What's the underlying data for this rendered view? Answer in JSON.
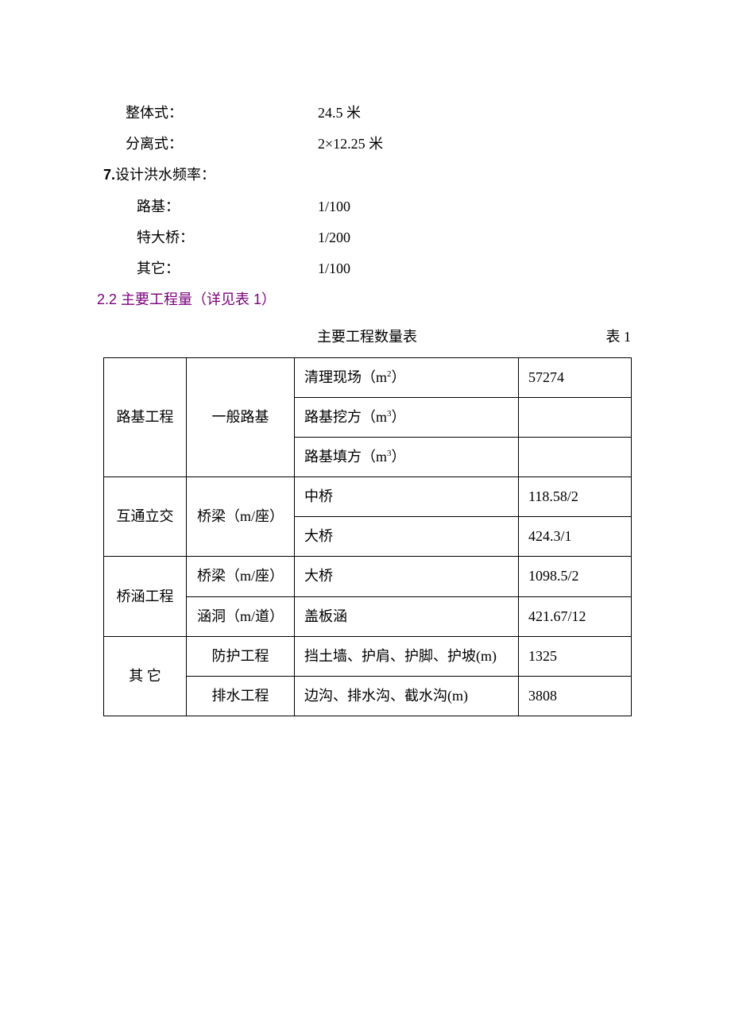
{
  "specs": [
    {
      "label": "整体式：",
      "value": "24.5 米",
      "cls": "indent-1"
    },
    {
      "label": "分离式：",
      "value": "2×12.25 米",
      "cls": "indent-1"
    },
    {
      "label_num": "7.",
      "label": "设计洪水频率：",
      "value": "",
      "cls": ""
    },
    {
      "label": "路基：",
      "value": "1/100",
      "cls": "indent-2"
    },
    {
      "label": "特大桥：",
      "value": "1/200",
      "cls": "indent-2"
    },
    {
      "label": "其它：",
      "value": "1/100",
      "cls": "indent-2"
    }
  ],
  "section_heading": "2.2 主要工程量（详见表 1）",
  "table_title": "主要工程数量表",
  "table_label": "表 1",
  "chart_data": {
    "type": "table",
    "rows": [
      {
        "c1": "路基工程",
        "c2": "一般路基",
        "c3": "清理现场（m²）",
        "c4": "57274"
      },
      {
        "c1": "",
        "c2": "",
        "c3": "路基挖方（m³）",
        "c4": ""
      },
      {
        "c1": "",
        "c2": "",
        "c3": "路基填方（m³）",
        "c4": ""
      },
      {
        "c1": "互通立交",
        "c2": "桥梁（m/座）",
        "c3": "中桥",
        "c4": "118.58/2"
      },
      {
        "c1": "",
        "c2": "",
        "c3": "大桥",
        "c4": "424.3/1"
      },
      {
        "c1": "桥涵工程",
        "c2": "桥梁（m/座）",
        "c3": "大桥",
        "c4": "1098.5/2"
      },
      {
        "c1": "",
        "c2": "涵洞（m/道）",
        "c3": "盖板涵",
        "c4": "421.67/12"
      },
      {
        "c1": "其 它",
        "c2": "防护工程",
        "c3": "挡土墙、护肩、护脚、护坡(m)",
        "c4": "1325"
      },
      {
        "c1": "",
        "c2": "排水工程",
        "c3": "边沟、排水沟、截水沟(m)",
        "c4": "3808"
      }
    ]
  }
}
